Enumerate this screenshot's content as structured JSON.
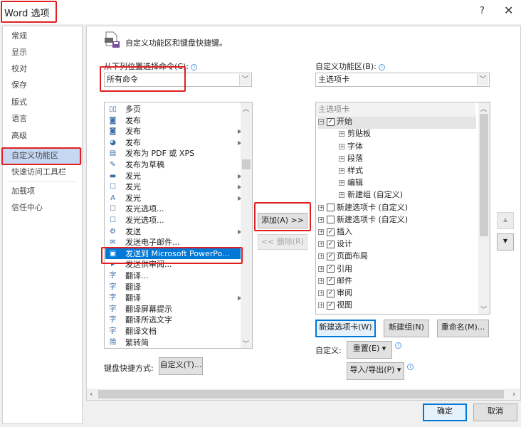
{
  "window": {
    "title": "Word 选项",
    "help_label": "?",
    "close_label": "✕"
  },
  "sidebar": {
    "items": [
      {
        "label": "常规"
      },
      {
        "label": "显示"
      },
      {
        "label": "校对"
      },
      {
        "label": "保存"
      },
      {
        "label": "版式"
      },
      {
        "label": "语言"
      },
      {
        "label": "高级"
      },
      {
        "label": "自定义功能区",
        "selected": true
      },
      {
        "label": "快速访问工具栏"
      },
      {
        "label": "加载项"
      },
      {
        "label": "信任中心"
      }
    ]
  },
  "main": {
    "heading": "自定义功能区和键盘快捷键。",
    "commands_label": "从下列位置选择命令(C):",
    "commands_value": "所有命令",
    "ribbon_label": "自定义功能区(B):",
    "ribbon_value": "主选项卡",
    "commands": [
      {
        "icon": "▯▯",
        "label": "多页",
        "submenu": false
      },
      {
        "icon": "◙",
        "label": "发布",
        "submenu": false
      },
      {
        "icon": "◙",
        "label": "发布",
        "submenu": true
      },
      {
        "icon": "◕",
        "label": "发布",
        "submenu": true
      },
      {
        "icon": "▤",
        "label": "发布为 PDF 或 XPS",
        "submenu": false
      },
      {
        "icon": "✎",
        "label": "发布为草稿",
        "submenu": false
      },
      {
        "icon": "▬",
        "label": "发光",
        "submenu": true
      },
      {
        "icon": "☐",
        "label": "发光",
        "submenu": true
      },
      {
        "icon": "A",
        "label": "发光",
        "submenu": true
      },
      {
        "icon": "☐",
        "label": "发光选项...",
        "submenu": false
      },
      {
        "icon": "☐",
        "label": "发光选项...",
        "submenu": false
      },
      {
        "icon": "⚙",
        "label": "发送",
        "submenu": true
      },
      {
        "icon": "✉",
        "label": "发送电子邮件...",
        "submenu": false
      },
      {
        "icon": "▣",
        "label": "发送到 Microsoft PowerPo...",
        "submenu": false,
        "selected": true
      },
      {
        "icon": "▸",
        "label": "发送供审阅...",
        "submenu": false
      },
      {
        "icon": "字",
        "label": "翻译...",
        "submenu": false
      },
      {
        "icon": "字",
        "label": "翻译",
        "submenu": false
      },
      {
        "icon": "字",
        "label": "翻译",
        "submenu": true
      },
      {
        "icon": "字",
        "label": "翻译屏幕提示",
        "submenu": false
      },
      {
        "icon": "字",
        "label": "翻译所选文字",
        "submenu": false
      },
      {
        "icon": "字",
        "label": "翻译文档",
        "submenu": false
      },
      {
        "icon": "简",
        "label": "繁转简",
        "submenu": false
      }
    ],
    "add_button": "添加(A) >>",
    "remove_button": "<< 删除(R)",
    "tree": [
      {
        "level": 0,
        "label": "主选项卡",
        "header": true
      },
      {
        "level": 1,
        "label": "开始",
        "expander": "⊟",
        "checked": true,
        "highlight": true
      },
      {
        "level": 2,
        "label": "剪贴板",
        "expander": "⊞"
      },
      {
        "level": 2,
        "label": "字体",
        "expander": "⊞"
      },
      {
        "level": 2,
        "label": "段落",
        "expander": "⊞"
      },
      {
        "level": 2,
        "label": "样式",
        "expander": "⊞"
      },
      {
        "level": 2,
        "label": "编辑",
        "expander": "⊞"
      },
      {
        "level": 2,
        "label": "新建组 (自定义)",
        "expander": "⊞"
      },
      {
        "level": 1,
        "label": "新建选项卡 (自定义)",
        "expander": "⊞",
        "checked": false
      },
      {
        "level": 1,
        "label": "新建选项卡 (自定义)",
        "expander": "⊞",
        "checked": false
      },
      {
        "level": 1,
        "label": "插入",
        "expander": "⊞",
        "checked": true
      },
      {
        "level": 1,
        "label": "设计",
        "expander": "⊞",
        "checked": true
      },
      {
        "level": 1,
        "label": "页面布局",
        "expander": "⊞",
        "checked": true
      },
      {
        "level": 1,
        "label": "引用",
        "expander": "⊞",
        "checked": true
      },
      {
        "level": 1,
        "label": "邮件",
        "expander": "⊞",
        "checked": true
      },
      {
        "level": 1,
        "label": "审阅",
        "expander": "⊞",
        "checked": true
      },
      {
        "level": 1,
        "label": "视图",
        "expander": "⊞",
        "checked": true
      }
    ],
    "new_tab_button": "新建选项卡(W)",
    "new_group_button": "新建组(N)",
    "rename_button": "重命名(M)...",
    "customize_label": "自定义:",
    "reset_button": "重置(E) ▾",
    "import_export_button": "导入/导出(P) ▾",
    "shortcut_label": "键盘快捷方式:",
    "shortcut_button": "自定义(T)...",
    "move_up": "▲",
    "move_down": "▼"
  },
  "footer": {
    "ok_button": "确定",
    "cancel_button": "取消"
  }
}
